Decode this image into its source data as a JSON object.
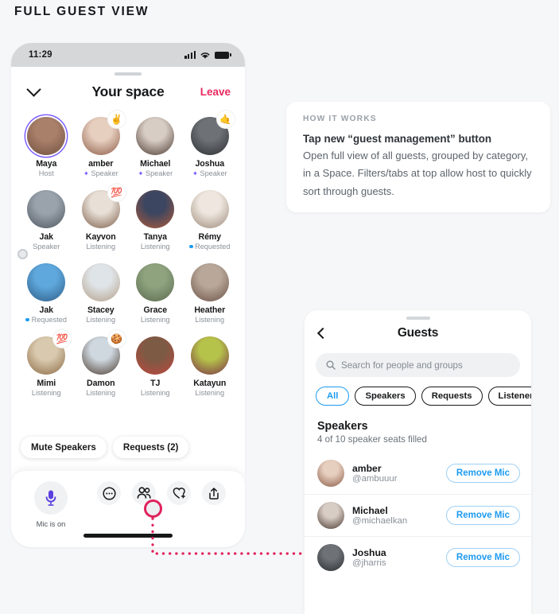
{
  "page_heading": "FULL GUEST VIEW",
  "phone": {
    "status_bar": {
      "time": "11:29",
      "signal_icon": "cellular-bars-icon",
      "wifi_icon": "wifi-icon",
      "battery_icon": "battery-icon"
    },
    "header": {
      "back_icon": "chevron-down-icon",
      "title": "Your space",
      "leave_label": "Leave"
    },
    "participants": [
      {
        "name": "Maya",
        "role": "Host",
        "badge": "none",
        "emoji": "",
        "ring": true,
        "color1": "#a9806a",
        "color2": "#6f4f3c"
      },
      {
        "name": "amber",
        "role": "Speaker",
        "badge": "mic",
        "emoji": "✌️",
        "ring": false,
        "color1": "#e7cfc0",
        "color2": "#8c5b46"
      },
      {
        "name": "Michael",
        "role": "Speaker",
        "badge": "mic",
        "emoji": "",
        "ring": false,
        "color1": "#d8cdc5",
        "color2": "#4b3a31"
      },
      {
        "name": "Joshua",
        "role": "Speaker",
        "badge": "mic",
        "emoji": "🤙",
        "ring": false,
        "color1": "#6e7277",
        "color2": "#2b2e31"
      },
      {
        "name": "Jak",
        "role": "Speaker",
        "badge": "none",
        "emoji": "",
        "ring": false,
        "color1": "#9aa3ac",
        "color2": "#4e565e"
      },
      {
        "name": "Kayvon",
        "role": "Listening",
        "badge": "none",
        "emoji": "💯",
        "ring": false,
        "color1": "#e8dfd6",
        "color2": "#7c5e4a"
      },
      {
        "name": "Tanya",
        "role": "Listening",
        "badge": "none",
        "emoji": "",
        "ring": false,
        "color1": "#3c4660",
        "color2": "#b05a3a"
      },
      {
        "name": "Rémy",
        "role": "Requested",
        "badge": "dot",
        "emoji": "",
        "ring": false,
        "color1": "#efe7df",
        "color2": "#9c8a79"
      },
      {
        "name": "Jak",
        "role": "Requested",
        "badge": "dot",
        "emoji": "",
        "ring": false,
        "color1": "#5fa8dd",
        "color2": "#2e5c86"
      },
      {
        "name": "Stacey",
        "role": "Listening",
        "badge": "none",
        "emoji": "",
        "ring": false,
        "color1": "#dfe4e8",
        "color2": "#b4a089"
      },
      {
        "name": "Grace",
        "role": "Listening",
        "badge": "none",
        "emoji": "",
        "ring": false,
        "color1": "#8fa37f",
        "color2": "#5a6a4e"
      },
      {
        "name": "Heather",
        "role": "Listening",
        "badge": "none",
        "emoji": "",
        "ring": false,
        "color1": "#b9a89a",
        "color2": "#6b5246"
      },
      {
        "name": "Mimi",
        "role": "Listening",
        "badge": "none",
        "emoji": "💯",
        "ring": false,
        "color1": "#d9c9ae",
        "color2": "#8a6a44"
      },
      {
        "name": "Damon",
        "role": "Listening",
        "badge": "none",
        "emoji": "🍪",
        "ring": false,
        "color1": "#cfd8df",
        "color2": "#4a3a30"
      },
      {
        "name": "TJ",
        "role": "Listening",
        "badge": "none",
        "emoji": "",
        "ring": false,
        "color1": "#7c5a44",
        "color2": "#c0473f"
      },
      {
        "name": "Katayun",
        "role": "Listening",
        "badge": "none",
        "emoji": "",
        "ring": false,
        "color1": "#b6c34a",
        "color2": "#7a3048"
      }
    ],
    "overlay_pills": [
      {
        "label": "Mute Speakers"
      },
      {
        "label": "Requests (2)"
      }
    ],
    "bottom_bar": {
      "mic_icon": "microphone-icon",
      "mic_label": "Mic is on",
      "actions": [
        {
          "icon": "emoji-reaction-icon"
        },
        {
          "icon": "guest-management-people-icon"
        },
        {
          "icon": "heart-plus-icon"
        },
        {
          "icon": "share-up-icon"
        }
      ]
    }
  },
  "how_it_works": {
    "kicker": "HOW IT WORKS",
    "title": "Tap new “guest management” button",
    "body": "Open full view of all guests, grouped by category, in a Space. Filters/tabs at top allow host to quickly sort through guests."
  },
  "guests_panel": {
    "back_icon": "chevron-left-icon",
    "title": "Guests",
    "search": {
      "icon": "search-icon",
      "placeholder": "Search for people and groups",
      "value": ""
    },
    "tabs": [
      {
        "label": "All",
        "active": true
      },
      {
        "label": "Speakers",
        "active": false
      },
      {
        "label": "Requests",
        "active": false
      },
      {
        "label": "Listeners",
        "active": false
      }
    ],
    "section": {
      "title": "Speakers",
      "subtitle": "4 of 10 speaker seats filled"
    },
    "rows": [
      {
        "name": "amber",
        "handle": "@ambuuur",
        "action": "Remove Mic",
        "color1": "#e7cfc0",
        "color2": "#8c5b46"
      },
      {
        "name": "Michael",
        "handle": "@michaelkan",
        "action": "Remove Mic",
        "color1": "#d8cdc5",
        "color2": "#4b3a31"
      },
      {
        "name": "Joshua",
        "handle": "@jharris",
        "action": "Remove Mic",
        "color1": "#6e7277",
        "color2": "#2b2e31"
      }
    ]
  },
  "colors": {
    "page_bg": "#f6f7f8",
    "accent_pink": "#e0215c",
    "leave_pink": "#e8295f",
    "speaker_purple": "#7856ff",
    "link_blue": "#1d9bf0",
    "mic_violet": "#5b3fe0"
  }
}
